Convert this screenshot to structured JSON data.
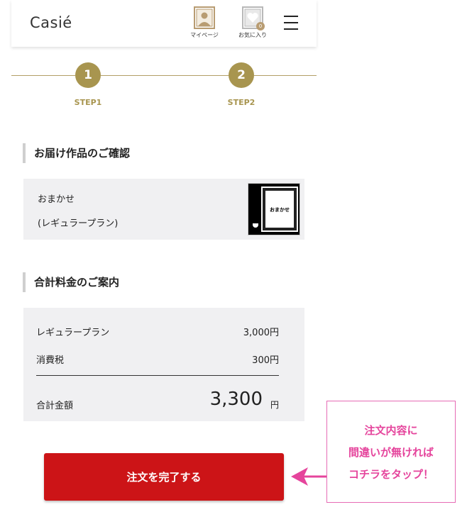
{
  "header": {
    "logo": "Casié",
    "mypage_label": "マイページ",
    "favorites_label": "お気に入り",
    "favorites_count": "0"
  },
  "progress": {
    "steps": [
      {
        "number": "1",
        "label": "STEP1"
      },
      {
        "number": "2",
        "label": "STEP2"
      }
    ],
    "accent_color": "#a8954f"
  },
  "delivery": {
    "title": "お届け作品のご確認",
    "plan_name": "おまかせ",
    "plan_type": "(レギュラープラン)",
    "thumbnail_text": "おまかせ"
  },
  "pricing": {
    "title": "合計料金のご案内",
    "items": [
      {
        "label": "レギュラープラン",
        "value": "3,000円"
      },
      {
        "label": "消費税",
        "value": "300円"
      }
    ],
    "total_label": "合計金額",
    "total_value": "3,300",
    "total_unit": "円"
  },
  "complete_button": {
    "label": "注文を完了する",
    "color": "#cc1417"
  },
  "callout": {
    "lines": [
      "注文内容に",
      "間違いが無ければ",
      "コチラをタップ！"
    ],
    "color": "#e5449c"
  }
}
